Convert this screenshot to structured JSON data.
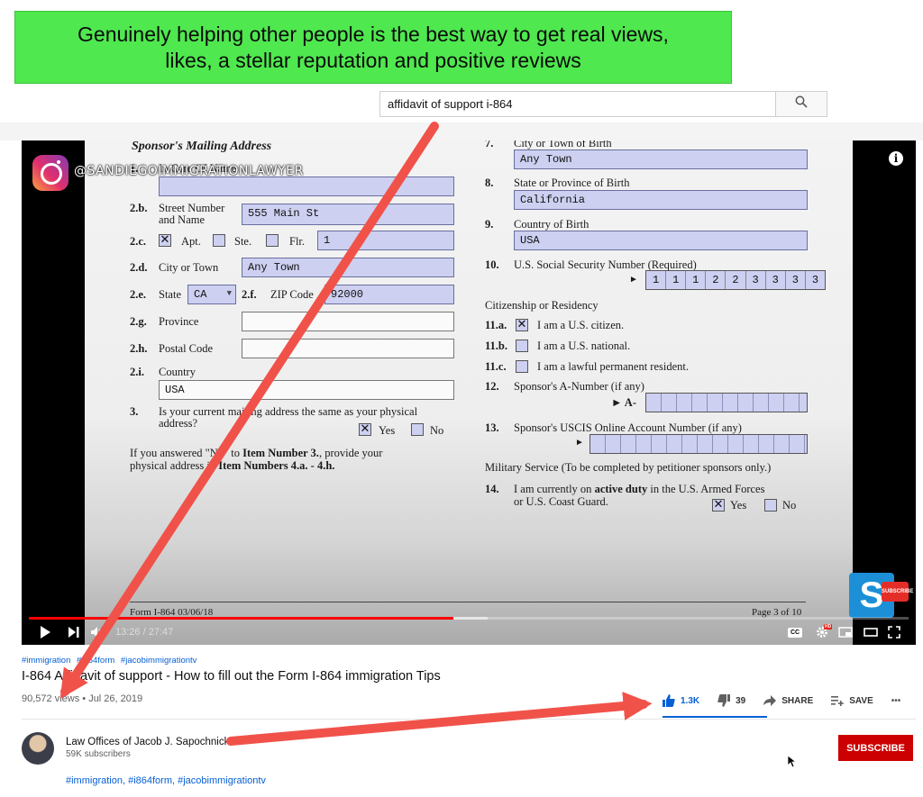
{
  "banner": {
    "line1": "Genuinely helping other people is the best way to get real views,",
    "line2": "likes, a stellar reputation and positive reviews",
    "color": "#4fe84f"
  },
  "search": {
    "value": "affidavit of support i-864",
    "button_icon": "search-icon"
  },
  "player": {
    "overlay_handle": "@SANDIEGOIMMIGRATIONLAWYER",
    "logo_letter": "S",
    "logo_badge": "SUBSCRIBE",
    "time_current": "13:26",
    "time_separator": " / ",
    "time_total": "27:47",
    "progress_fraction": 0.483,
    "buffered_fraction": 0.522,
    "progress_color": "#ff0000",
    "hd_badge": "HD",
    "cc_label": "CC"
  },
  "form": {
    "heading": "Sponsor's Mailing Address",
    "row_1": "1.",
    "row_1_label": "In Care Of Name",
    "row_2b": "2.b.",
    "row_2b_label_1": "Street Number",
    "row_2b_label_2": "and Name",
    "street": "555 Main St",
    "row_2c": "2.c.",
    "apt_check": "✕",
    "apt": "Apt.",
    "ste": "Ste.",
    "flr": "Flr.",
    "unit": "1",
    "row_2d": "2.d.",
    "city_label": "City or Town",
    "city": "Any Town",
    "row_2e": "2.e.",
    "state_label": "State",
    "state": "CA",
    "row_2f": "2.f.",
    "zip_label": "ZIP Code",
    "zip": "92000",
    "row_2g": "2.g.",
    "province_label": "Province",
    "row_2h": "2.h.",
    "postal_label": "Postal Code",
    "row_2i": "2.i.",
    "country_label": "Country",
    "country": "USA",
    "row_3": "3.",
    "q3_line1": "Is your current mailing address the same as your physical",
    "q3_line2": "address?",
    "q3_yes_check": "✕",
    "q3_yes": "Yes",
    "q3_no": "No",
    "note_line1_a": "If you answered \"No\" to ",
    "note_line1_b": "Item Number 3.",
    "note_line1_c": ", provide your",
    "note_line2_a": "physical address in ",
    "note_line2_b": "Item Numbers 4.a. - 4.h.",
    "row_7": "7.",
    "birth_city_label": "City or Town of Birth",
    "birth_city": "Any Town",
    "row_8": "8.",
    "birth_state_label": "State or Province of Birth",
    "birth_state": "California",
    "row_9": "9.",
    "birth_country_label": "Country of Birth",
    "birth_country": "USA",
    "row_10": "10.",
    "ssn_label": "U.S. Social Security Number (Required)",
    "ssn_arrow": "►",
    "ssn_digits": [
      "1",
      "1",
      "1",
      "2",
      "2",
      "3",
      "3",
      "3",
      "3"
    ],
    "citizenship_heading": "Citizenship or Residency",
    "row_11a": "11.a.",
    "c11a_check": "✕",
    "c11a": "I am a U.S. citizen.",
    "row_11b": "11.b.",
    "c11b": "I am a U.S. national.",
    "row_11c": "11.c.",
    "c11c": "I am a lawful permanent resident.",
    "row_12": "12.",
    "a_number_label": "Sponsor's A-Number (if any)",
    "a_prefix": "► A-",
    "row_13": "13.",
    "uscis_label": "Sponsor's USCIS Online Account Number (if any)",
    "uscis_arrow": "►",
    "military_heading": "Military Service (To be completed by petitioner sponsors only.)",
    "row_14": "14.",
    "q14_line1_a": "I am currently on ",
    "q14_line1_b": "active duty",
    "q14_line1_c": " in the U.S. Armed Forces",
    "q14_line2": "or U.S. Coast Guard.",
    "q14_yes_check": "✕",
    "q14_yes": "Yes",
    "q14_no": "No",
    "footer_left": "Form I-864   03/06/18",
    "footer_right": "Page 3 of 10"
  },
  "video": {
    "tags": [
      "#immigration",
      "#i864form",
      "#jacobimmigrationtv"
    ],
    "title": "I-864 Affidavit of support - How to fill out the Form I-864 immigration Tips",
    "views": "90,572 views",
    "separator": " • ",
    "date": "Jul 26, 2019",
    "likes": "1.3K",
    "dislikes": "39",
    "share": "SHARE",
    "save": "SAVE",
    "more": "•••",
    "like_color": "#065fd4"
  },
  "channel": {
    "name": "Law Offices of Jacob J. Sapochnick",
    "subscribers": "59K subscribers",
    "hashtags": "#immigration, #i864form, #jacobimmigrationtv",
    "subscribe_label": "SUBSCRIBE",
    "subscribe_color": "#cc0000"
  },
  "annotation_color": "#f0524a"
}
